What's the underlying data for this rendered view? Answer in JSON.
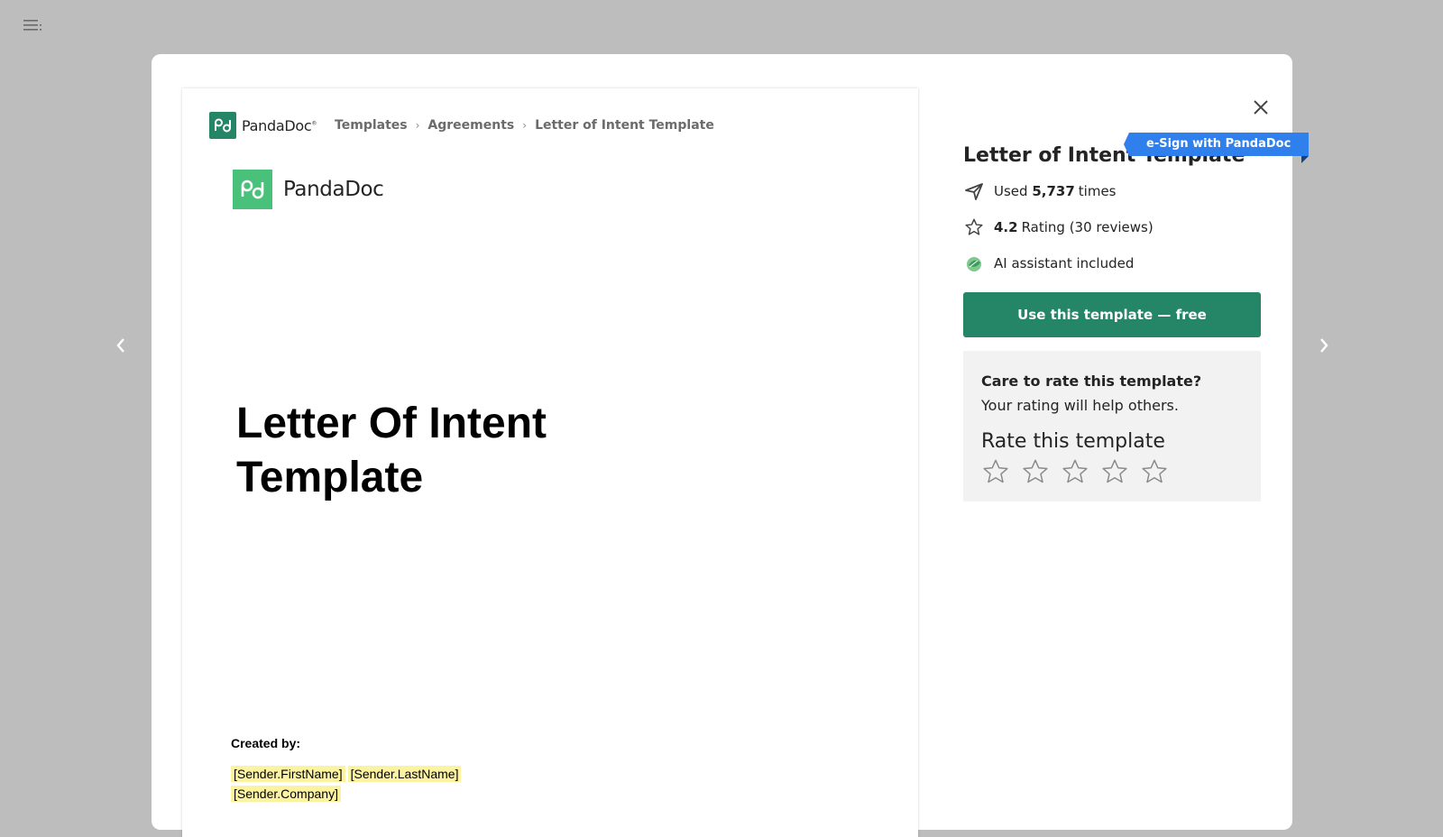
{
  "header": {
    "logo_text": "PandaDoc",
    "breadcrumb": [
      {
        "label": "Templates"
      },
      {
        "label": "Agreements"
      },
      {
        "label": "Letter of Intent Template"
      }
    ]
  },
  "document": {
    "logo_text": "PandaDoc",
    "title_line1": "Letter Of Intent",
    "title_line2": "Template",
    "created_by_label": "Created by:",
    "tokens": {
      "first_name": "[Sender.FirstName]",
      "last_name": "[Sender.LastName]",
      "company": "[Sender.Company]"
    }
  },
  "side": {
    "title": "Letter of Intent Template",
    "badge": "e-Sign with PandaDoc",
    "used_prefix": "Used",
    "used_count": "5,737",
    "used_suffix": "times",
    "rating_value": "4.2",
    "rating_text": "Rating (30 reviews)",
    "ai_text": "AI assistant included",
    "cta": "Use this template — free",
    "rate_question": "Care to rate this template?",
    "rate_help": "Your rating will help others.",
    "rate_label": "Rate this template",
    "stars_selected": 0
  },
  "colors": {
    "brand_green": "#248567",
    "logo_green": "#49c17a",
    "badge_blue": "#2f80ed",
    "token_highlight": "#fbf3a0",
    "overlay": "#bdbdbd"
  },
  "icons": [
    "menu-icon",
    "chevron-left-icon",
    "chevron-right-icon",
    "close-icon",
    "send-icon",
    "star-outline-icon",
    "ai-leaf-icon",
    "pandadoc-logo-icon"
  ]
}
